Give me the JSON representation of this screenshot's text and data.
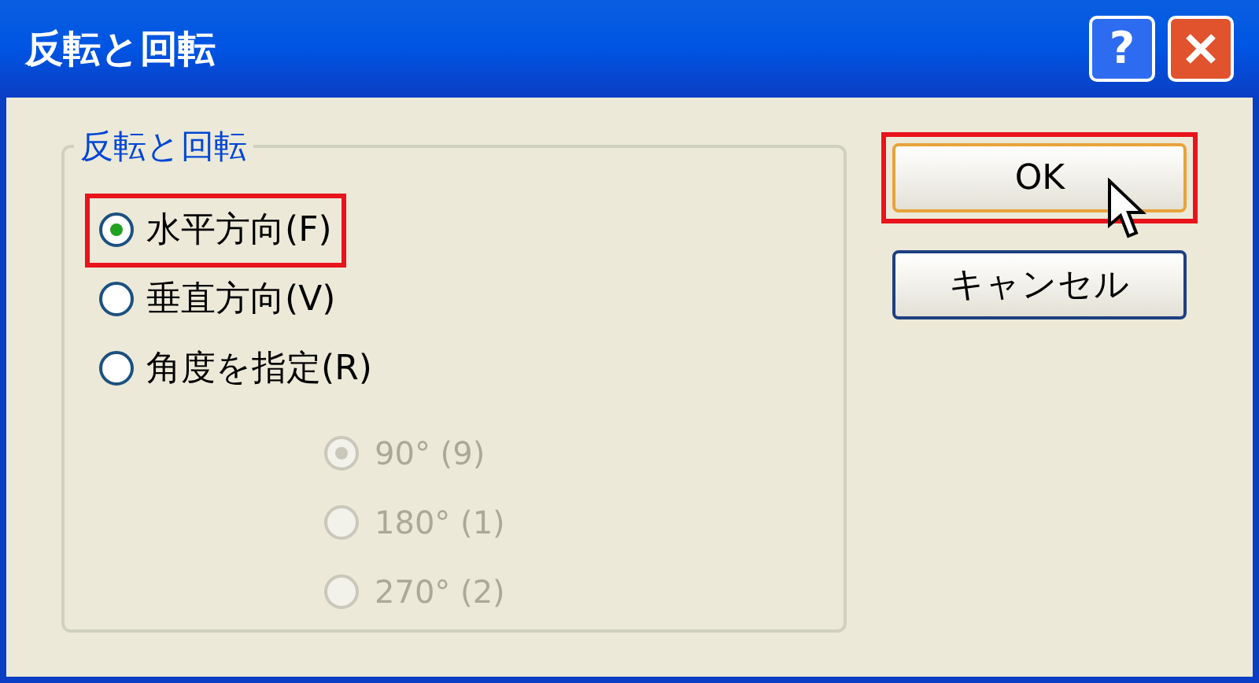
{
  "window": {
    "title": "反転と回転",
    "help_button": "?"
  },
  "group": {
    "label": "反転と回転",
    "options": [
      {
        "label": "水平方向(F)",
        "selected": true,
        "highlighted": true
      },
      {
        "label": "垂直方向(V)",
        "selected": false,
        "highlighted": false
      },
      {
        "label": "角度を指定(R)",
        "selected": false,
        "highlighted": false
      }
    ],
    "angles": [
      {
        "label": "90° (9)",
        "selected": true,
        "disabled": true
      },
      {
        "label": "180° (1)",
        "selected": false,
        "disabled": true
      },
      {
        "label": "270° (2)",
        "selected": false,
        "disabled": true
      }
    ]
  },
  "buttons": [
    {
      "label": "OK",
      "default": true,
      "highlighted": true
    },
    {
      "label": "キャンセル",
      "default": false,
      "highlighted": false
    }
  ]
}
